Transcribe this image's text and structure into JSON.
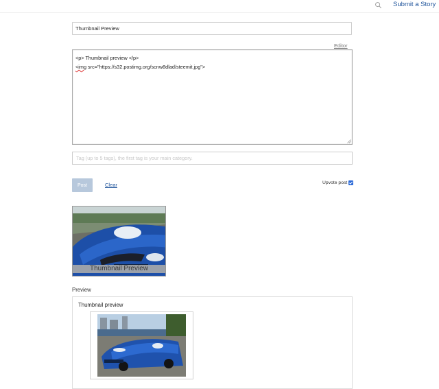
{
  "header": {
    "submit_label": "Submit a Story"
  },
  "form": {
    "title_value": "Thumbnail Preview",
    "editor_link": "Editor",
    "body_lines": {
      "line1": "<p> Thumbnail preview </p>",
      "line2_tag": "<img",
      "line2_rest": " src=\"https://s32.postimg.org/scnw8dlad/steemit.jpg\">"
    },
    "tags_placeholder": "Tag (up to 5 tags), the first tag is your main category.",
    "post_label": "Post",
    "clear_label": "Clear",
    "upvote_label": "Upvote post",
    "upvote_checked": true
  },
  "thumbnail": {
    "caption": "Thumbnail Preview"
  },
  "preview": {
    "label": "Preview",
    "text": "Thumbnail preview"
  },
  "colors": {
    "link": "#1a5099",
    "post_button": "#b7c8dc",
    "checkbox": "#2e6bd8"
  }
}
